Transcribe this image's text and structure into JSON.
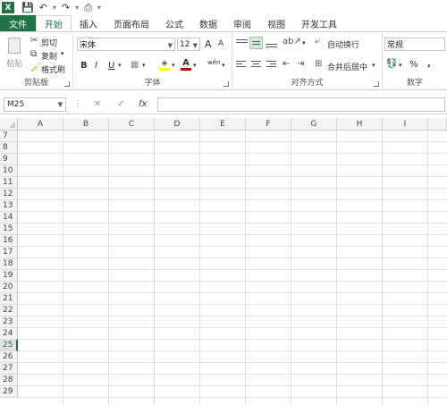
{
  "app": {
    "logo": "X"
  },
  "qat": {
    "save": "💾",
    "undo": "↶",
    "redo": "↷",
    "preview": "⎙",
    "more": "▾"
  },
  "tabs": [
    {
      "label": "文件"
    },
    {
      "label": "开始"
    },
    {
      "label": "插入"
    },
    {
      "label": "页面布局"
    },
    {
      "label": "公式"
    },
    {
      "label": "数据"
    },
    {
      "label": "审阅"
    },
    {
      "label": "视图"
    },
    {
      "label": "开发工具"
    }
  ],
  "ribbon": {
    "clipboard": {
      "paste": "粘贴",
      "cut": "剪切",
      "copy": "复制",
      "format_painter": "格式刷",
      "label": "剪贴板"
    },
    "font": {
      "name": "宋体",
      "size": "12",
      "grow": "A",
      "shrink": "A",
      "bold": "B",
      "italic": "I",
      "underline": "U",
      "phonetic": "wén",
      "label": "字体"
    },
    "alignment": {
      "wrap": "自动换行",
      "merge": "合并后居中",
      "label": "对齐方式"
    },
    "number": {
      "format": "常规",
      "percent": "%",
      "comma": ",",
      "label": "数字"
    }
  },
  "formula_bar": {
    "cell_ref": "M25",
    "cancel": "✕",
    "enter": "✓",
    "fx": "fx",
    "value": ""
  },
  "grid": {
    "columns": [
      "A",
      "B",
      "C",
      "D",
      "E",
      "F",
      "G",
      "H",
      "I"
    ],
    "rows": [
      "7",
      "8",
      "9",
      "10",
      "11",
      "12",
      "13",
      "14",
      "15",
      "16",
      "17",
      "18",
      "19",
      "20",
      "21",
      "22",
      "23",
      "24",
      "25",
      "26",
      "27",
      "28",
      "29"
    ],
    "selected_row": "25"
  },
  "colors": {
    "accent": "#217346"
  }
}
